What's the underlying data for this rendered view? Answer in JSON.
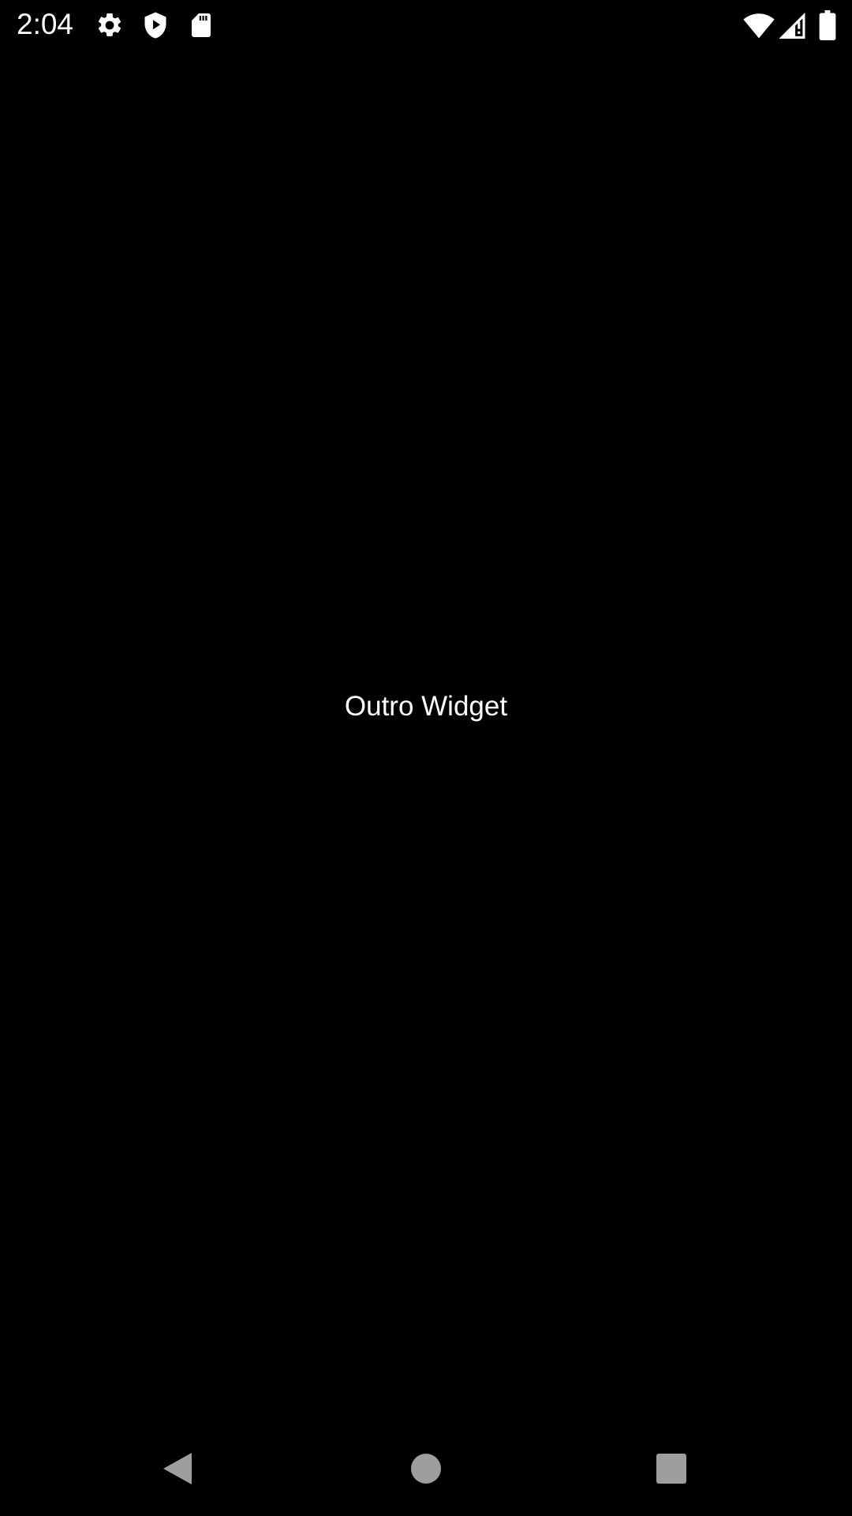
{
  "status_bar": {
    "time": "2:04",
    "left_icons": [
      "gear-icon",
      "play-shield-icon",
      "sd-card-icon"
    ],
    "right_icons": [
      "wifi-icon",
      "cellular-signal-icon",
      "battery-icon"
    ]
  },
  "main": {
    "label": "Outro Widget"
  },
  "nav_bar": {
    "buttons": [
      "back",
      "home",
      "recents"
    ]
  },
  "colors": {
    "background": "#000000",
    "text": "#ffffff",
    "nav_icon": "#9e9e9e"
  }
}
